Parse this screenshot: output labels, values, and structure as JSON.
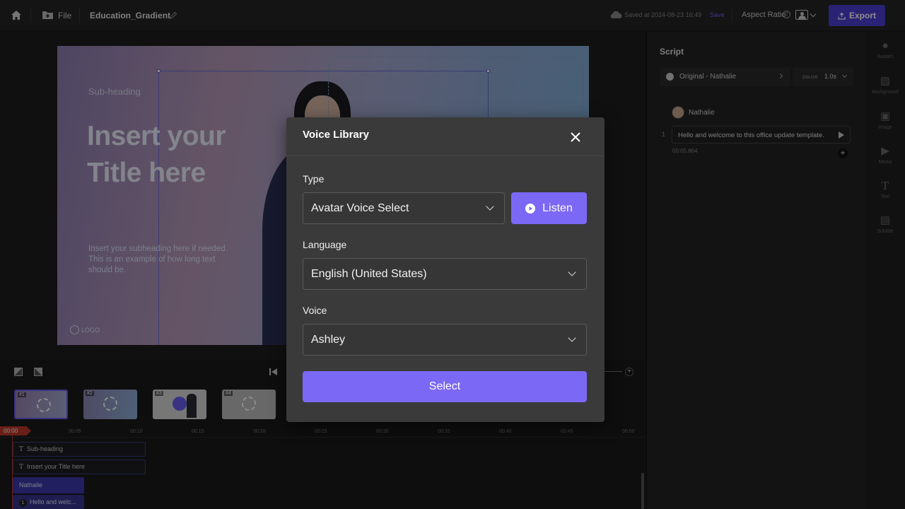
{
  "topbar": {
    "file_label": "File",
    "project_name": "Education_Gradient",
    "saved_text": "Saved at 2024-08-23 16:49",
    "save_label": "Save",
    "aspect_ratio_label": "Aspect Ratio",
    "export_label": "Export"
  },
  "slide": {
    "subheading": "Sub-heading",
    "title_line1": "Insert your",
    "title_line2": "Title here",
    "body_line1": "Insert your subheading here if needed.",
    "body_line2": "This is an example of how long text",
    "body_line3": "should be.",
    "logo_text": "LOGO"
  },
  "script_panel": {
    "title": "Script",
    "voice_source": "Original - Nathalie",
    "pause_label": "pause",
    "pause_value": "1.0s",
    "speaker": "Nathalie",
    "line_number": "1",
    "line_text": "Hello and welcome to this office update template.",
    "line_time": "00:05.864"
  },
  "right_rail": {
    "items": [
      "Avatars",
      "Background",
      "Image",
      "Media",
      "Text",
      "Subtitle"
    ]
  },
  "timeline": {
    "scenes": [
      "#1",
      "#2",
      "#3",
      "#4"
    ],
    "current_time": "00:00",
    "ticks": [
      "00:05",
      "00:10",
      "00:15",
      "00:20",
      "00:25",
      "00:30",
      "00:35",
      "00:40",
      "00:45",
      "00:50"
    ],
    "tracks": {
      "subheading": "Sub-heading",
      "title": "Insert your Title here",
      "avatar": "Nathalie",
      "audio_number": "1",
      "audio": "Hello and welc..."
    }
  },
  "modal": {
    "title": "Voice Library",
    "type_label": "Type",
    "type_value": "Avatar Voice Select",
    "listen_label": "Listen",
    "language_label": "Language",
    "language_value": "English (United States)",
    "voice_label": "Voice",
    "voice_value": "Ashley",
    "select_label": "Select"
  },
  "colors": {
    "accent": "#7b68f5",
    "export": "#4b3fd6",
    "save_link": "#6d63ff",
    "playhead": "#c0392b"
  },
  "icons": [
    "home-icon",
    "folder-plus-icon",
    "pencil-icon",
    "cloud-icon",
    "help-icon",
    "person-frame-icon",
    "upload-icon",
    "close-icon",
    "play-circle-icon",
    "chevron-down-icon"
  ]
}
